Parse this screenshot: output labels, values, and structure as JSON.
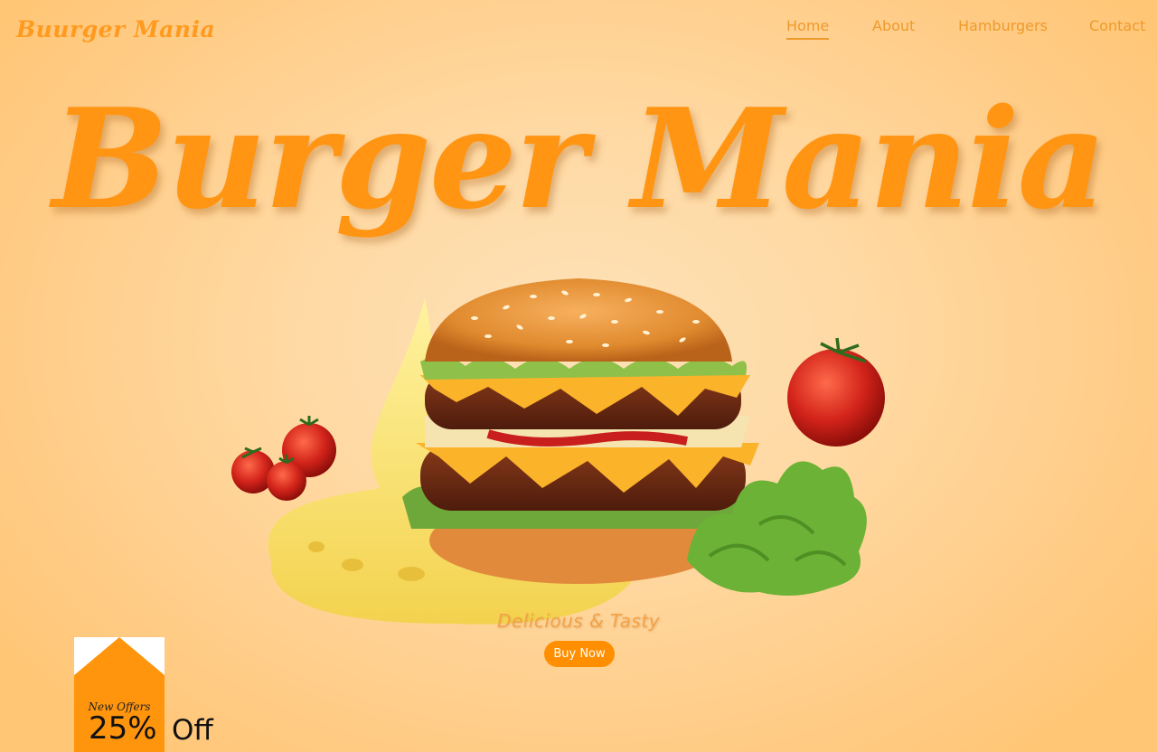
{
  "brand": {
    "logo": "Buurger Mania"
  },
  "nav": {
    "items": [
      {
        "label": "Home",
        "active": true
      },
      {
        "label": "About"
      },
      {
        "label": "Hamburgers"
      },
      {
        "label": "Contact"
      }
    ]
  },
  "hero": {
    "title": "Burger Mania",
    "tagline": "Delicious & Tasty",
    "cta": "Buy Now",
    "image_icon": "burger-illustration"
  },
  "offer": {
    "label": "New Offers",
    "percent": "25%",
    "suffix": "Off"
  },
  "colors": {
    "accent": "#ff9512",
    "button": "#ff8e00",
    "background": "#ffd9a3"
  }
}
